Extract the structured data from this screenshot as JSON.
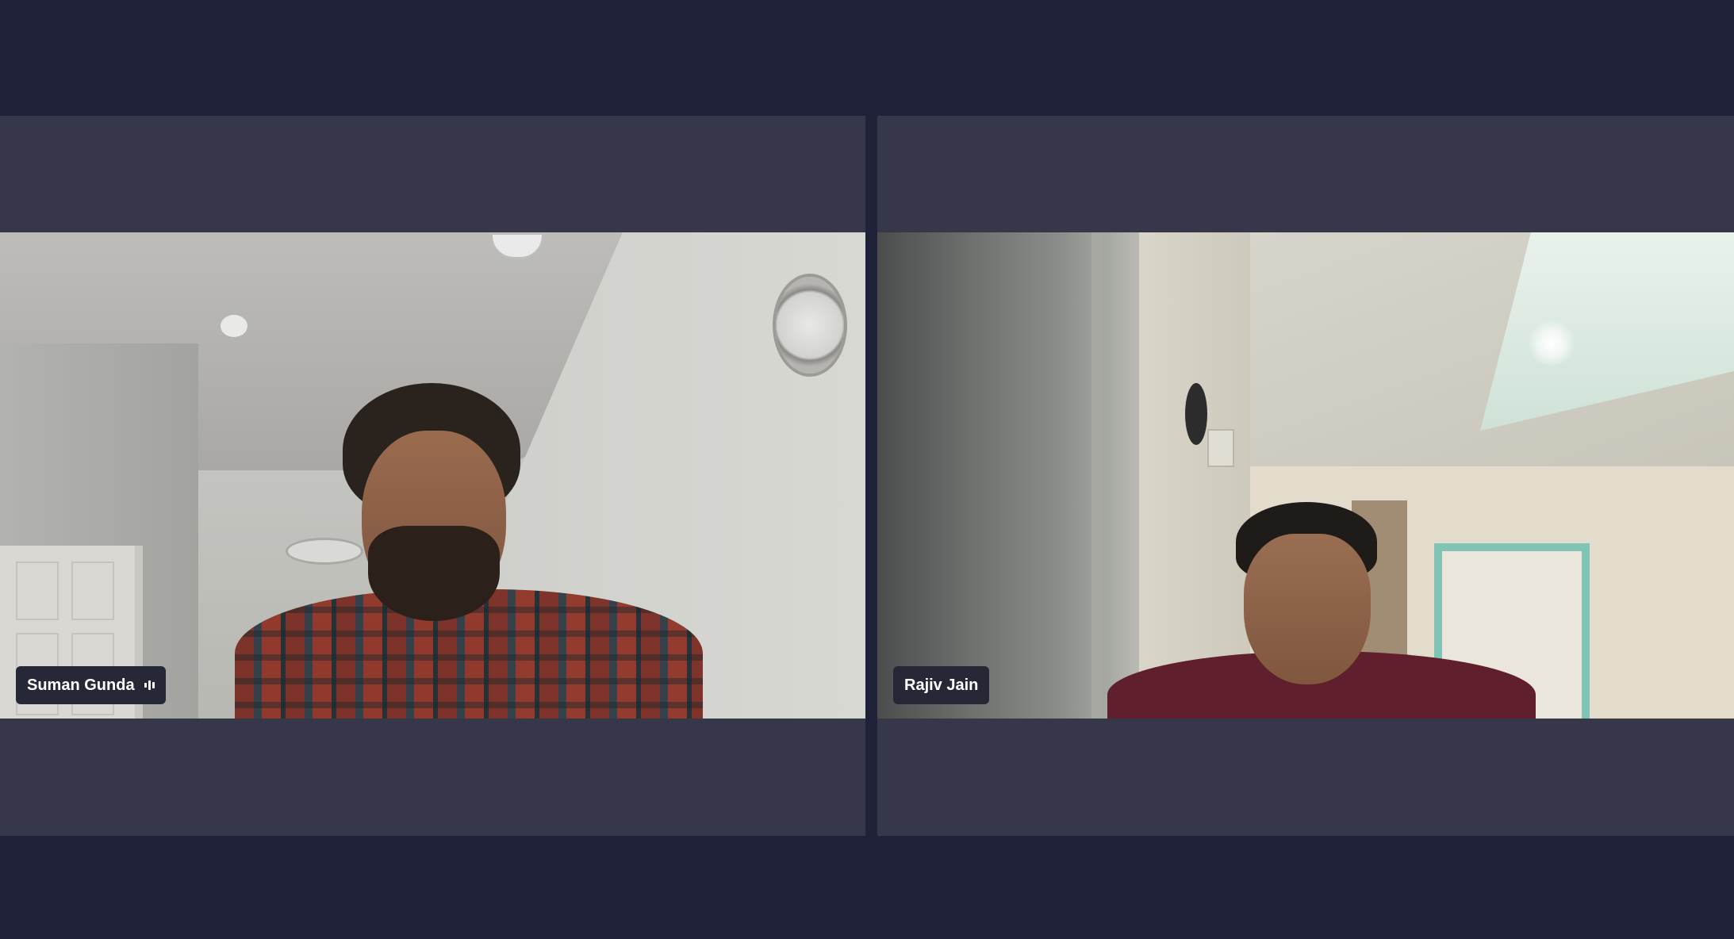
{
  "meeting": {
    "participants": [
      {
        "name": "Suman Gunda",
        "audio_indicator": "audio-level-icon"
      },
      {
        "name": "Rajiv Jain"
      }
    ]
  },
  "colors": {
    "background": "#20223a",
    "tile": "#363849",
    "badge": "#262838",
    "badge_text": "#ffffff"
  }
}
